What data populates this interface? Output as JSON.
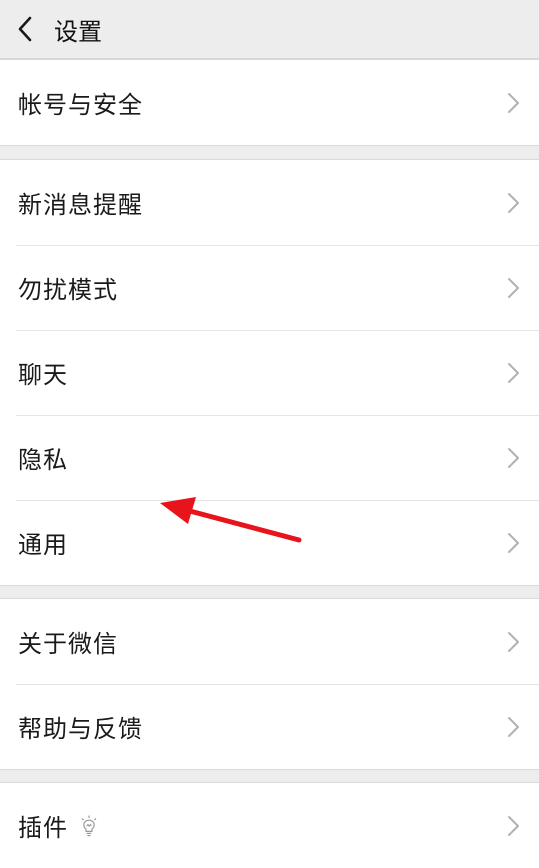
{
  "header": {
    "title": "设置",
    "back_icon": "chevron-left-icon"
  },
  "groups": [
    {
      "items": [
        {
          "label": "帐号与安全"
        }
      ]
    },
    {
      "items": [
        {
          "label": "新消息提醒"
        },
        {
          "label": "勿扰模式"
        },
        {
          "label": "聊天"
        },
        {
          "label": "隐私"
        },
        {
          "label": "通用"
        }
      ]
    },
    {
      "items": [
        {
          "label": "关于微信"
        },
        {
          "label": "帮助与反馈"
        }
      ]
    },
    {
      "items": [
        {
          "label": "插件",
          "icon": "lightbulb-icon"
        }
      ]
    }
  ],
  "annotation": {
    "arrow_color": "#e8141b",
    "pointing_to": "通用"
  },
  "colors": {
    "background": "#ededed",
    "row_background": "#ffffff",
    "chevron": "#b2b2b2"
  }
}
